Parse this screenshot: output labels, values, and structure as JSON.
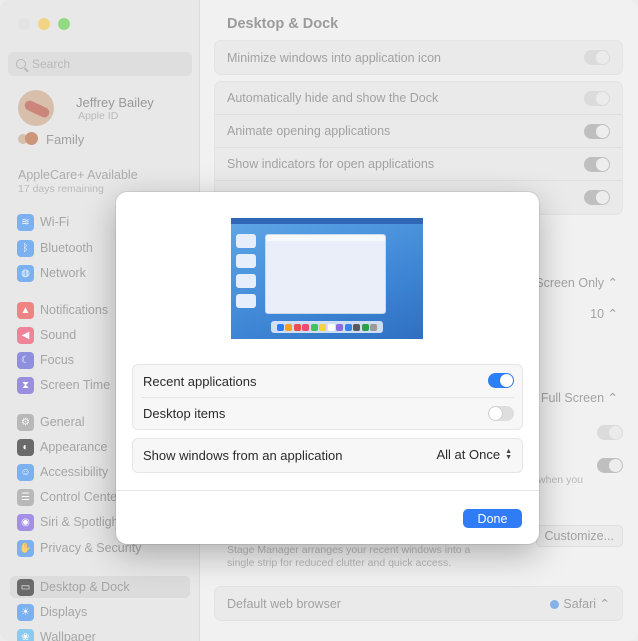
{
  "window": {
    "title": "Desktop & Dock",
    "colors": {
      "close": "#dcdcdc",
      "minimize": "#f2c54a",
      "maximize": "#5fcf4c",
      "accent": "#2f7cf6"
    }
  },
  "sidebar": {
    "search_placeholder": "Search",
    "profile": {
      "name": "Jeffrey Bailey",
      "subtitle": "Apple ID"
    },
    "family": "Family",
    "applecare": {
      "title": "AppleCare+ Available",
      "subtitle": "17 days remaining"
    },
    "items": [
      {
        "label": "Wi-Fi",
        "icon": "wifi-icon",
        "color": "#3c8ef2"
      },
      {
        "label": "Bluetooth",
        "icon": "bluetooth-icon",
        "color": "#3c8ef2"
      },
      {
        "label": "Network",
        "icon": "globe-icon",
        "color": "#3c8ef2"
      },
      {
        "label": "Notifications",
        "icon": "bell-icon",
        "color": "#ef4b4b"
      },
      {
        "label": "Sound",
        "icon": "speaker-icon",
        "color": "#ef4b6b"
      },
      {
        "label": "Focus",
        "icon": "moon-icon",
        "color": "#5b5bd6"
      },
      {
        "label": "Screen Time",
        "icon": "hourglass-icon",
        "color": "#6c5bd6"
      },
      {
        "label": "General",
        "icon": "gear-icon",
        "color": "#9a9a9a"
      },
      {
        "label": "Appearance",
        "icon": "appearance-icon",
        "color": "#222222"
      },
      {
        "label": "Accessibility",
        "icon": "accessibility-icon",
        "color": "#3c8ef2"
      },
      {
        "label": "Control Cente",
        "icon": "control-center-icon",
        "color": "#9a9a9a"
      },
      {
        "label": "Siri & Spotligh",
        "icon": "siri-icon",
        "color": "#7a5be0"
      },
      {
        "label": "Privacy & Security",
        "icon": "hand-icon",
        "color": "#3c8ef2"
      },
      {
        "label": "Desktop & Dock",
        "icon": "dock-icon",
        "color": "#222222",
        "selected": true
      },
      {
        "label": "Displays",
        "icon": "sun-icon",
        "color": "#3c8ef2"
      },
      {
        "label": "Wallpaper",
        "icon": "wallpaper-icon",
        "color": "#56b4f0"
      }
    ]
  },
  "main": {
    "rows_top": [
      {
        "label": "Minimize windows into application icon",
        "on": false
      },
      {
        "label": "Automatically hide and show the Dock",
        "on": false
      },
      {
        "label": "Animate opening applications",
        "on": true
      },
      {
        "label": "Show indicators for open applications",
        "on": true
      }
    ],
    "partial": {
      "screen_only": "Screen Only",
      "ten": "10",
      "full_screen": "Full Screen",
      "when_you": "when you",
      "customize": "Customize...",
      "stage_note_1": "Stage Manager arranges your recent windows into a",
      "stage_note_2": "single strip for reduced clutter and quick access.",
      "default_browser_label": "Default web browser",
      "default_browser_value": "Safari"
    }
  },
  "sheet": {
    "recent_applications": {
      "label": "Recent applications",
      "on": true
    },
    "desktop_items": {
      "label": "Desktop items",
      "on": false
    },
    "show_windows": {
      "label": "Show windows from an application",
      "value": "All at Once"
    },
    "done_label": "Done",
    "dock_colors": [
      "#2f7cf6",
      "#f4a224",
      "#ef4b4b",
      "#ef4b6b",
      "#44c15a",
      "#f5d33c",
      "#ffffff",
      "#8a6be0",
      "#3a83e6",
      "#5a5a5a",
      "#2aa24a",
      "#9a9a9a"
    ]
  }
}
